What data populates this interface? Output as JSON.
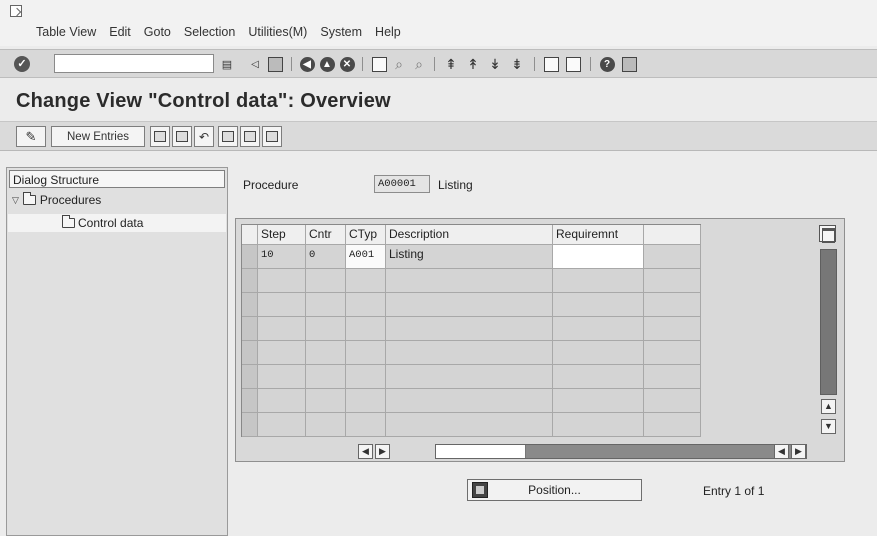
{
  "menubar": {
    "items": [
      "Table View",
      "Edit",
      "Goto",
      "Selection",
      "Utilities(M)",
      "System",
      "Help"
    ]
  },
  "toolbar": {
    "command_value": "",
    "icons": [
      "enter-icon",
      "command-history-icon",
      "back-arrow-icon",
      "save-icon",
      "back-icon",
      "exit-icon",
      "cancel-icon",
      "print-icon",
      "find-icon",
      "find-next-icon",
      "first-page-icon",
      "previous-page-icon",
      "next-page-icon",
      "last-page-icon",
      "create-session-icon",
      "shortcut-icon",
      "help-icon",
      "layout-menu-icon"
    ]
  },
  "page": {
    "title": "Change View \"Control data\": Overview"
  },
  "app_toolbar": {
    "new_entries_label": "New Entries"
  },
  "dialog_structure": {
    "header": "Dialog Structure",
    "items": [
      {
        "label": "Procedures",
        "expanded": true
      },
      {
        "label": "Control data",
        "selected": true
      }
    ]
  },
  "procedure": {
    "label": "Procedure",
    "value": "A00001",
    "description": "Listing"
  },
  "table": {
    "columns": [
      "Step",
      "Cntr",
      "CTyp",
      "Description",
      "Requiremnt",
      ""
    ],
    "rows": [
      {
        "step": "10",
        "cntr": "0",
        "ctyp": "A001",
        "description": "Listing",
        "requirement": ""
      }
    ]
  },
  "position_button": {
    "label": "Position..."
  },
  "entry_info": "Entry 1 of 1"
}
